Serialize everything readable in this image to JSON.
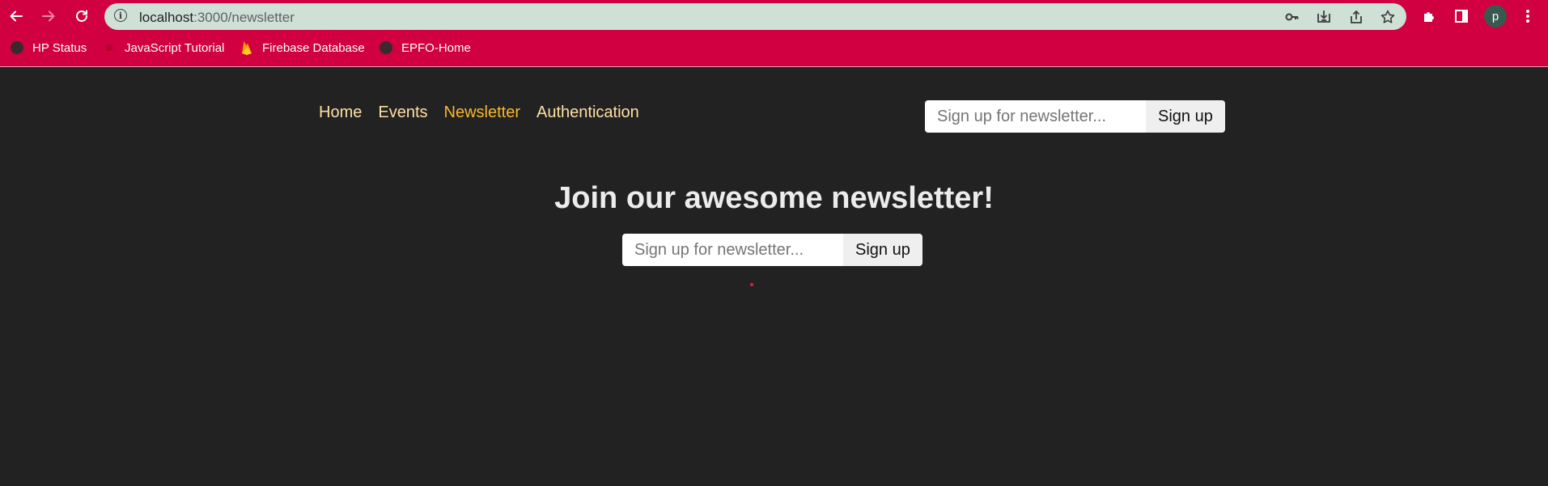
{
  "browser": {
    "url_host": "localhost",
    "url_path": ":3000/newsletter",
    "bookmarks": [
      {
        "label": "HP Status",
        "icon": "globe-icon"
      },
      {
        "label": "JavaScript Tutorial",
        "icon": "tutorial-favicon"
      },
      {
        "label": "Firebase Database",
        "icon": "firebase-icon"
      },
      {
        "label": "EPFO-Home",
        "icon": "globe-icon"
      }
    ],
    "profile_initial": "p",
    "colors": {
      "frame": "#d10041",
      "omnibox": "#cfe0d6"
    }
  },
  "nav": {
    "links": [
      {
        "label": "Home",
        "active": false
      },
      {
        "label": "Events",
        "active": false
      },
      {
        "label": "Newsletter",
        "active": true
      },
      {
        "label": "Authentication",
        "active": false
      }
    ],
    "signup": {
      "placeholder": "Sign up for newsletter...",
      "button": "Sign up"
    }
  },
  "main": {
    "title": "Join our awesome newsletter!",
    "signup": {
      "placeholder": "Sign up for newsletter...",
      "button": "Sign up"
    }
  },
  "colors": {
    "page_bg": "#222222",
    "nav_link": "#ffe0a3",
    "nav_active": "#fcb82c"
  }
}
